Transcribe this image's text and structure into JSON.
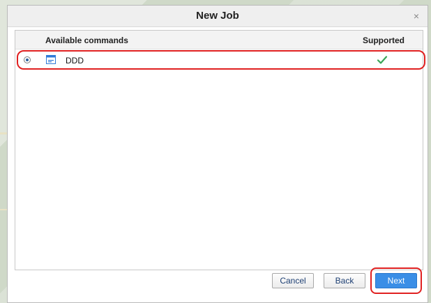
{
  "dialog": {
    "title": "New Job",
    "close_glyph": "×"
  },
  "table": {
    "columns": [
      "Available commands",
      "Supported"
    ],
    "rows": [
      {
        "selected": true,
        "icon": "command-icon",
        "name": "DDD",
        "supported": true,
        "supported_icon": "checkmark-icon"
      }
    ]
  },
  "footer": {
    "buttons": [
      "Cancel",
      "Back",
      "Next"
    ]
  },
  "colors": {
    "primary_button": "#3a8ee6",
    "annotation_outline": "#e02020",
    "check_green": "#3aa657",
    "icon_blue": "#2f7bd8"
  }
}
